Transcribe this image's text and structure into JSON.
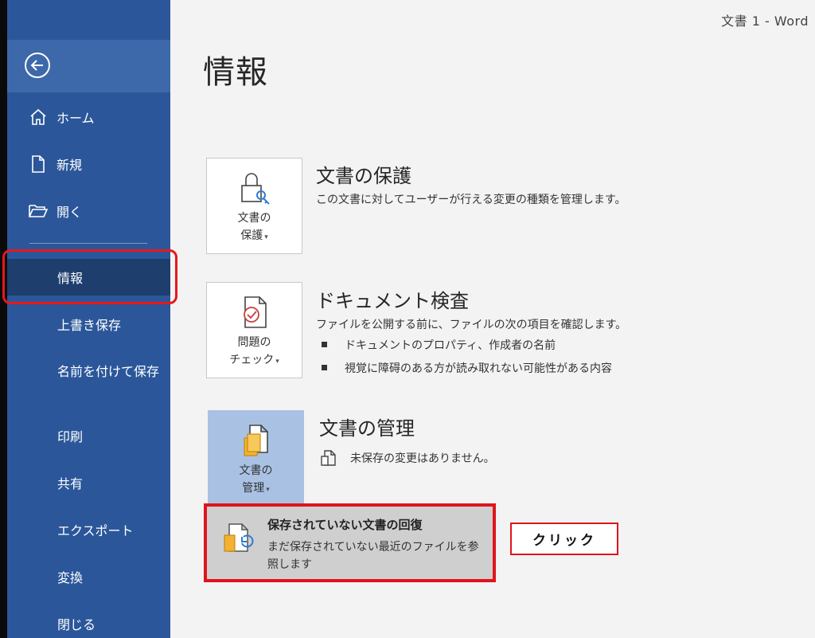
{
  "window": {
    "title": "文書 1  -  Word"
  },
  "sidebar": {
    "back_icon": "arrow-left-circle-icon",
    "items": [
      {
        "label": "ホーム",
        "icon": "home-icon"
      },
      {
        "label": "新規",
        "icon": "new-document-icon"
      },
      {
        "label": "開く",
        "icon": "folder-open-icon"
      },
      {
        "label": "情報"
      },
      {
        "label": "上書き保存"
      },
      {
        "label": "名前を付けて保存"
      },
      {
        "label": "印刷"
      },
      {
        "label": "共有"
      },
      {
        "label": "エクスポート"
      },
      {
        "label": "変換"
      },
      {
        "label": "閉じる"
      }
    ],
    "active_item": "情報"
  },
  "main": {
    "title": "情報",
    "sections": [
      {
        "tile_label_1": "文書の",
        "tile_label_2": "保護",
        "title": "文書の保護",
        "description": "この文書に対してユーザーが行える変更の種類を管理します。",
        "icon": "lock-key-icon"
      },
      {
        "tile_label_1": "問題の",
        "tile_label_2": "チェック",
        "title": "ドキュメント検査",
        "description": "ファイルを公開する前に、ファイルの次の項目を確認します。",
        "bullets": [
          "ドキュメントのプロパティ、作成者の名前",
          "視覚に障碍のある方が読み取れない可能性がある内容"
        ],
        "icon": "document-check-icon"
      },
      {
        "tile_label_1": "文書の",
        "tile_label_2": "管理",
        "title": "文書の管理",
        "status": "未保存の変更はありません。",
        "icon": "manage-document-icon"
      }
    ],
    "dropdown": {
      "title": "保存されていない文書の回復",
      "description": "まだ保存されていない最近のファイルを参照します",
      "icon": "recover-document-icon"
    }
  },
  "annotation": {
    "callout": "クリック"
  },
  "colors": {
    "sidebar": "#2b579a",
    "sidebar_active": "#1e3e6e",
    "highlight": "#e0141a",
    "selected_tile": "#a9c2e4"
  }
}
